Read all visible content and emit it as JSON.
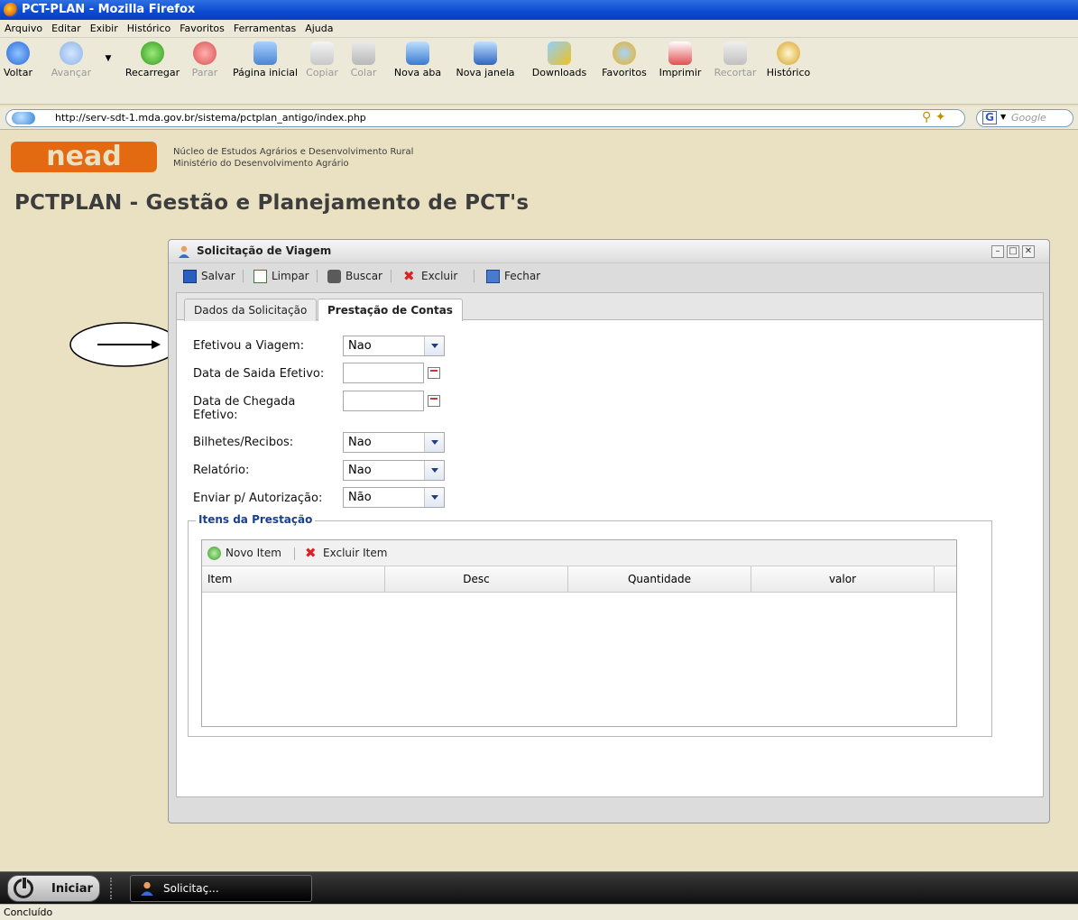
{
  "window": {
    "title": "PCT-PLAN - Mozilla Firefox"
  },
  "menu": [
    "Arquivo",
    "Editar",
    "Exibir",
    "Histórico",
    "Favoritos",
    "Ferramentas",
    "Ajuda"
  ],
  "toolbar": {
    "voltar": "Voltar",
    "avancar": "Avançar",
    "recarregar": "Recarregar",
    "parar": "Parar",
    "pagina_inicial": "Página inicial",
    "copiar": "Copiar",
    "colar": "Colar",
    "nova_aba": "Nova aba",
    "nova_janela": "Nova janela",
    "downloads": "Downloads",
    "favoritos": "Favoritos",
    "imprimir": "Imprimir",
    "recortar": "Recortar",
    "historico": "Histórico"
  },
  "address": {
    "url": "http://serv-sdt-1.mda.gov.br/sistema/pctplan_antigo/index.php",
    "search_placeholder": "Google"
  },
  "header": {
    "logo_text": "nead",
    "org_line1": "Núcleo de Estudos Agrários e Desenvolvimento Rural",
    "org_line2": "Ministério do Desenvolvimento Agrário",
    "app_title": "PCTPLAN - Gestão e Planejamento de PCT's"
  },
  "dialog": {
    "title": "Solicitação de Viagem",
    "buttons": {
      "salvar": "Salvar",
      "limpar": "Limpar",
      "buscar": "Buscar",
      "excluir": "Excluir",
      "fechar": "Fechar"
    },
    "tabs": [
      {
        "label": "Dados da Solicitação"
      },
      {
        "label": "Prestação de Contas"
      }
    ],
    "fields": {
      "efetivou_label": "Efetivou a Viagem:",
      "efetivou_value": "Nao",
      "saida_label": "Data de Saida Efetivo:",
      "saida_value": "",
      "chegada_label_1": "Data de Chegada",
      "chegada_label_2": "Efetivo:",
      "chegada_value": "",
      "bilhetes_label": "Bilhetes/Recibos:",
      "bilhetes_value": "Nao",
      "relatorio_label": "Relatório:",
      "relatorio_value": "Nao",
      "enviar_label": "Enviar p/ Autorização:",
      "enviar_value": "Não"
    },
    "itens": {
      "legend": "Itens da Prestação",
      "novo_item": "Novo Item",
      "excluir_item": "Excluir Item",
      "columns": [
        "Item",
        "Desc",
        "Quantidade",
        "valor"
      ]
    }
  },
  "taskbar": {
    "start": "Iniciar",
    "task": "Solicitaç..."
  },
  "status": "Concluído"
}
